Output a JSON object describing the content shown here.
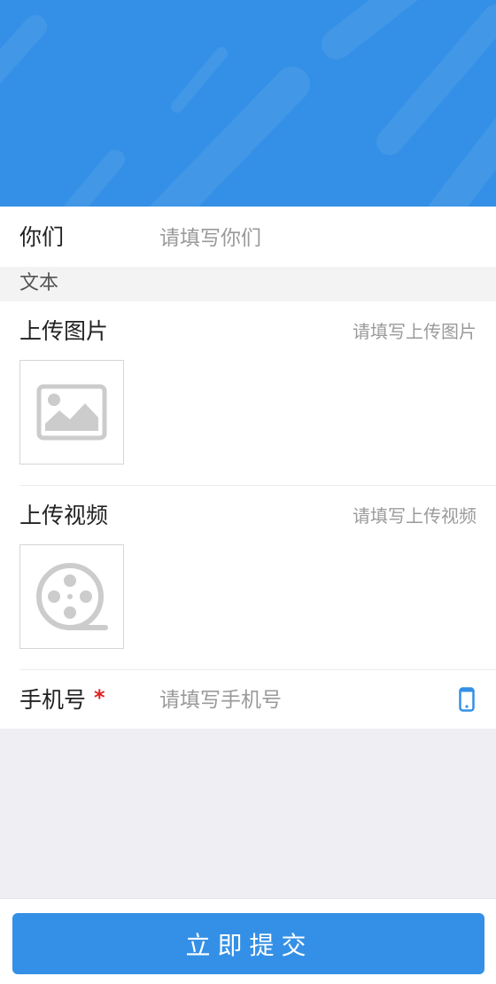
{
  "colors": {
    "primary": "#3490e6",
    "required": "#e02020",
    "placeholder": "#9a9a9a",
    "label": "#222222",
    "background": "#eeeef3"
  },
  "fields": {
    "you": {
      "label": "你们",
      "placeholder": "请填写你们"
    },
    "text_section": {
      "label": "文本"
    },
    "upload_image": {
      "label": "上传图片",
      "placeholder": "请填写上传图片",
      "icon": "image-icon"
    },
    "upload_video": {
      "label": "上传视频",
      "placeholder": "请填写上传视频",
      "icon": "film-reel-icon"
    },
    "phone": {
      "label": "手机号",
      "required_mark": "*",
      "placeholder": "请填写手机号",
      "icon": "mobile-phone-icon"
    }
  },
  "submit": {
    "label": "立即提交"
  }
}
